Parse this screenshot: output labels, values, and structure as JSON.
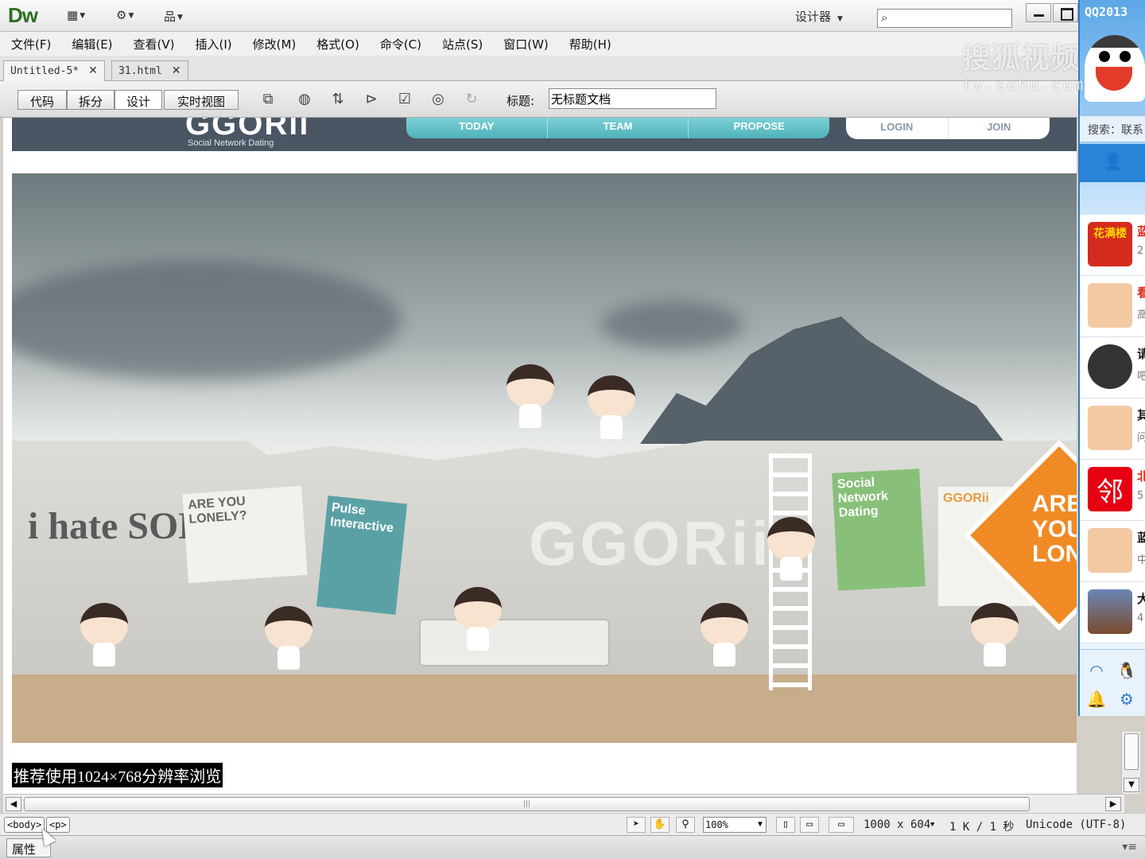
{
  "app": {
    "logo": "Dw",
    "workspace": "设计器"
  },
  "menu": [
    "文件(F)",
    "编辑(E)",
    "查看(V)",
    "插入(I)",
    "修改(M)",
    "格式(O)",
    "命令(C)",
    "站点(S)",
    "窗口(W)",
    "帮助(H)"
  ],
  "tabs": [
    {
      "label": "Untitled-5*",
      "active": true
    },
    {
      "label": "31.html",
      "active": false
    }
  ],
  "view_buttons": [
    "代码",
    "拆分",
    "设计",
    "实时视图"
  ],
  "active_view": "设计",
  "doc_title": {
    "label": "标题:",
    "value": "无标题文档"
  },
  "site": {
    "logo": "GGORii",
    "tagline": "Social Network Dating",
    "nav": [
      "TODAY",
      "TEAM",
      "PROPOSE"
    ],
    "auth": [
      "LOGIN",
      "JOIN"
    ],
    "posters": {
      "lonely": "ARE YOU LONELY?",
      "pulse": "Pulse Interactive",
      "social": "Social Network Dating",
      "brand": "GGORii"
    },
    "graffiti": "i hate SOLO",
    "wall_logo": "GGORii",
    "sign": "ARE YOU LONELY"
  },
  "recommend_text": "推荐使用1024×768分辨率浏览",
  "statusbar": {
    "tags": [
      "<body>",
      "<p>"
    ],
    "zoom": "100%",
    "dimensions": "1000 x 604",
    "size_time": "1 K / 1 秒",
    "encoding": "Unicode (UTF-8)"
  },
  "properties_label": "属性",
  "qq": {
    "title": "QQ2013",
    "search_label": "搜索：联系",
    "contacts": [
      {
        "avatar": "花满楼",
        "line1": "蓝",
        "line2": "2"
      },
      {
        "avatar": "",
        "line1": "看",
        "line2": "高"
      },
      {
        "avatar": "",
        "line1": "请",
        "line2": "吧"
      },
      {
        "avatar": "",
        "line1": "其",
        "line2": "问"
      },
      {
        "avatar": "邻",
        "line1": "北",
        "line2": "5"
      },
      {
        "avatar": "",
        "line1": "蓝",
        "line2": "中"
      },
      {
        "avatar": "",
        "line1": "大",
        "line2": "4"
      }
    ]
  },
  "watermark": {
    "brand": "搜狐视频",
    "url": "tv.sohu.com"
  },
  "colors": {
    "accent": "#2d6e23",
    "site_header": "#4a5663",
    "nav_teal": "#5bbcc2",
    "qq_blue": "#2e7ac4"
  }
}
